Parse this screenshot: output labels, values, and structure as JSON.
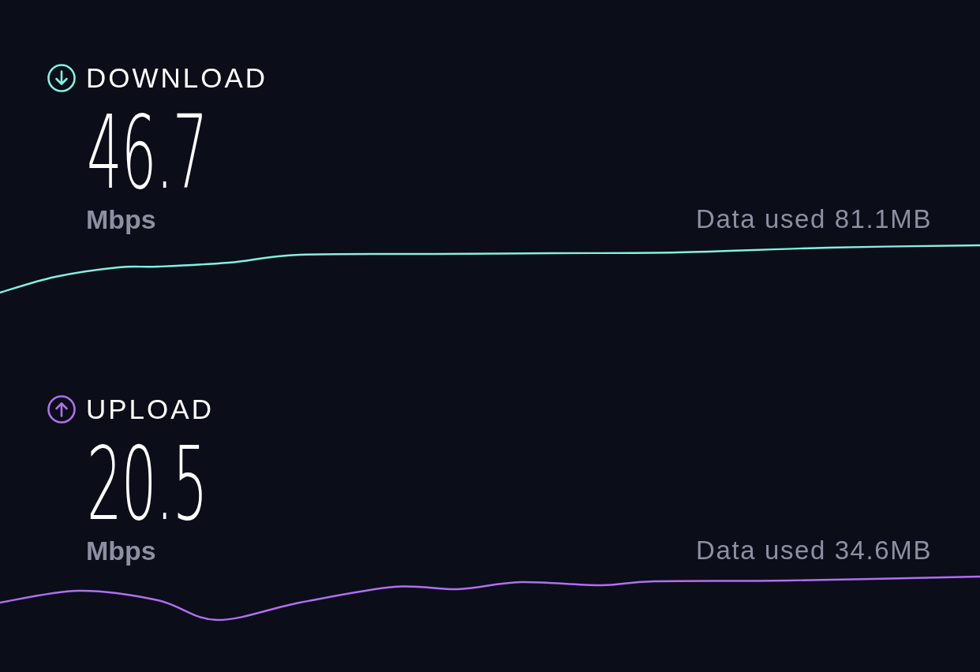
{
  "sections": [
    {
      "kind": "download",
      "title": "DOWNLOAD",
      "color": "#80f2e4",
      "value": "46.7",
      "unit": "Mbps",
      "data_used": "Data used 81.1MB"
    },
    {
      "kind": "upload",
      "title": "UPLOAD",
      "color": "#b06ff2",
      "value": "20.5",
      "unit": "Mbps",
      "data_used": "Data used 34.6MB"
    }
  ]
}
